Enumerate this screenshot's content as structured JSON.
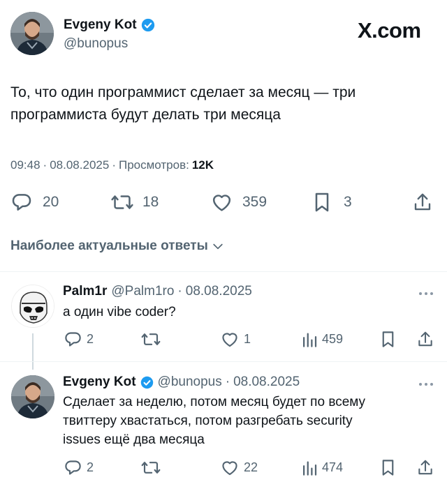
{
  "brand": {
    "logo_text": "X.com"
  },
  "main_tweet": {
    "author_name": "Evgeny Kot",
    "author_handle": "@bunopus",
    "text_line1": "То, что один программист сделает за месяц — три",
    "text_line2": "программиста будут делать три месяца",
    "time": "09:48",
    "date": "08.08.2025",
    "views_label": "Просмотров:",
    "views_count": "12K",
    "stats": {
      "replies": "20",
      "reposts": "18",
      "likes": "359",
      "bookmarks": "3"
    }
  },
  "replies_header": {
    "label": "Наиболее актуальные ответы"
  },
  "replies": [
    {
      "author_name": "Palm1r",
      "author_handle": "@Palm1ro",
      "date": "08.08.2025",
      "text_line1": "а один vibe coder?",
      "stats": {
        "replies": "2",
        "reposts": "",
        "likes": "1",
        "views": "459"
      }
    },
    {
      "author_name": "Evgeny Kot",
      "author_handle": "@bunopus",
      "date": "08.08.2025",
      "text_line1": "Сделает за неделю, потом месяц будет по всему",
      "text_line2": "твиттеру хвастаться, потом разгребать security",
      "text_line3": "issues ещё два месяца",
      "stats": {
        "replies": "2",
        "reposts": "",
        "likes": "22",
        "views": "474"
      }
    }
  ],
  "colors": {
    "text": "#0f1419",
    "muted": "#536471",
    "verified": "#1d9bf0",
    "divider": "#eff3f4"
  },
  "icons": [
    "reply-icon",
    "repost-icon",
    "like-icon",
    "bookmark-icon",
    "share-icon",
    "views-icon",
    "more-icon",
    "verified-icon",
    "chevron-down-icon"
  ]
}
